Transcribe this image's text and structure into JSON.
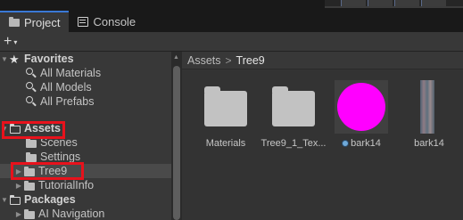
{
  "tabs": [
    {
      "label": "Project",
      "icon": "folder-icon",
      "active": true
    },
    {
      "label": "Console",
      "icon": "console-icon",
      "active": false
    }
  ],
  "create": {
    "plus": "+",
    "caret": "▾"
  },
  "tree": {
    "favorites": {
      "label": "Favorites",
      "items": [
        "All Materials",
        "All Models",
        "All Prefabs"
      ]
    },
    "assets": {
      "label": "Assets",
      "items": [
        "Scenes",
        "Settings",
        "Tree9",
        "TutorialInfo"
      ]
    },
    "packages": {
      "label": "Packages",
      "items": [
        "AI Navigation"
      ]
    }
  },
  "breadcrumb": {
    "root": "Assets",
    "separator": ">",
    "current": "Tree9"
  },
  "grid_items": [
    {
      "label": "Materials",
      "kind": "folder"
    },
    {
      "label": "Tree9_1_Tex...",
      "kind": "folder"
    },
    {
      "label": "bark14",
      "kind": "material"
    },
    {
      "label": "bark14",
      "kind": "texture"
    }
  ],
  "colors": {
    "material_preview": "#ff00ff",
    "highlight_box": "#e8121c",
    "active_tab_accent": "#3a79d6"
  }
}
